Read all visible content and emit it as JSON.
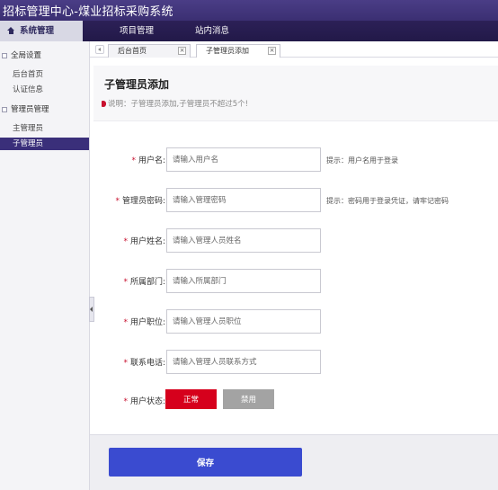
{
  "app": {
    "title": "招标管理中心-煤业招标采购系统"
  },
  "nav": {
    "items": [
      {
        "label": "系统管理",
        "active": true
      },
      {
        "label": "项目管理"
      },
      {
        "label": "站内消息"
      }
    ]
  },
  "sidebar": {
    "groups": [
      {
        "label": "全局设置",
        "items": [
          "后台首页",
          "认证信息"
        ]
      },
      {
        "label": "管理员管理",
        "items": [
          "主管理员",
          "子管理员"
        ]
      }
    ],
    "selected": "子管理员"
  },
  "tabs": [
    {
      "label": "后台首页",
      "close": "×"
    },
    {
      "label": "子管理员添加",
      "close": "×",
      "active": true
    }
  ],
  "page": {
    "title": "子管理员添加",
    "note": "说明：子管理员添加,子管理员不超过5个!"
  },
  "form": {
    "required_mark": "*",
    "fields": [
      {
        "label": "用户名:",
        "placeholder": "请输入用户名",
        "hint": "提示：用户名用于登录"
      },
      {
        "label": "管理员密码:",
        "placeholder": "请输入管理密码",
        "hint": "提示：密码用于登录凭证，请牢记密码"
      },
      {
        "label": "用户姓名:",
        "placeholder": "请输入管理人员姓名"
      },
      {
        "label": "所属部门:",
        "placeholder": "请输入所属部门"
      },
      {
        "label": "用户职位:",
        "placeholder": "请输入管理人员职位"
      },
      {
        "label": "联系电话:",
        "placeholder": "请输入管理人员联系方式"
      }
    ],
    "status": {
      "label": "用户状态:",
      "options": [
        "正常",
        "禁用"
      ],
      "selected": "正常"
    }
  },
  "actions": {
    "save_label": "保存"
  },
  "colors": {
    "header": "#3b2f72",
    "accent_red": "#d6001c",
    "save_blue": "#3a4bd0"
  }
}
